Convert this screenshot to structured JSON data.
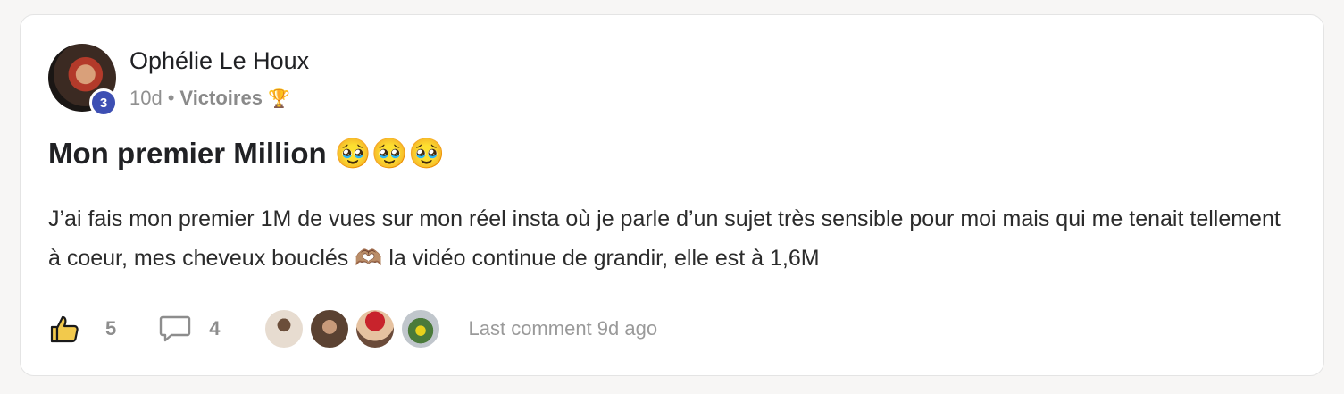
{
  "post": {
    "author": "Ophélie Le Houx",
    "level": "3",
    "time_ago": "10d",
    "separator": "•",
    "category": "Victoires",
    "category_emoji": "🏆",
    "title": "Mon premier Million 🥹🥹🥹",
    "body": "J’ai fais mon premier 1M de vues sur mon réel insta où je parle d’un sujet très sensible pour moi mais qui me tenait tellement à coeur, mes cheveux bouclés 🫶🏽  la vidéo continue de grandir, elle est à 1,6M",
    "likes": "5",
    "comments": "4",
    "last_comment": "Last comment 9d ago"
  },
  "icons": {
    "like": "thumbs-up-icon",
    "comment": "comment-bubble-icon"
  },
  "colors": {
    "level_badge": "#3d4fb3",
    "like_icon_fill": "#f2c94c"
  }
}
